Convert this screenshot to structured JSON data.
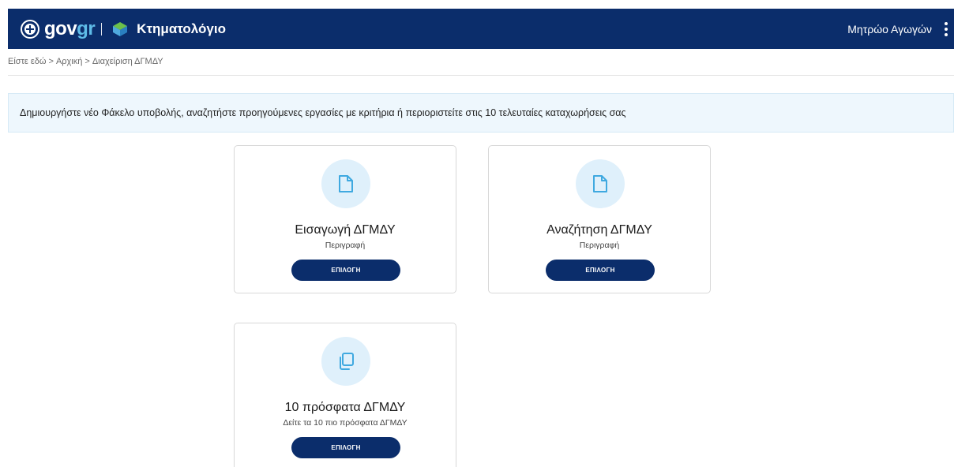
{
  "header": {
    "gov_text": "gov",
    "gov_accent": "gr",
    "product": "Κτηματολόγιο",
    "user_menu_label": "Μητρώο Αγωγών",
    "colors": {
      "bar": "#0b2d6b",
      "accent": "#5fbce8"
    }
  },
  "breadcrumb": {
    "prefix": "Είστε εδώ",
    "items": [
      "Αρχική",
      "Διαχείριση ΔΓΜΔΥ"
    ]
  },
  "banner": {
    "text": "Δημιουργήστε νέο Φάκελο υποβολής, αναζητήστε προηγούμενες εργασίες με κριτήρια ή περιοριστείτε στις 10 τελευταίες καταχωρήσεις σας"
  },
  "cards": [
    {
      "icon": "document-icon",
      "title": "Εισαγωγή ΔΓΜΔΥ",
      "description": "Περιγραφή",
      "button": "ΕΠΙΛΟΓΗ"
    },
    {
      "icon": "document-icon",
      "title": "Αναζήτηση ΔΓΜΔΥ",
      "description": "Περιγραφή",
      "button": "ΕΠΙΛΟΓΗ"
    },
    {
      "icon": "copy-icon",
      "title": "10 πρόσφατα ΔΓΜΔΥ",
      "description": "Δείτε τα 10 πιο πρόσφατα ΔΓΜΔΥ",
      "button": "ΕΠΙΛΟΓΗ"
    }
  ]
}
